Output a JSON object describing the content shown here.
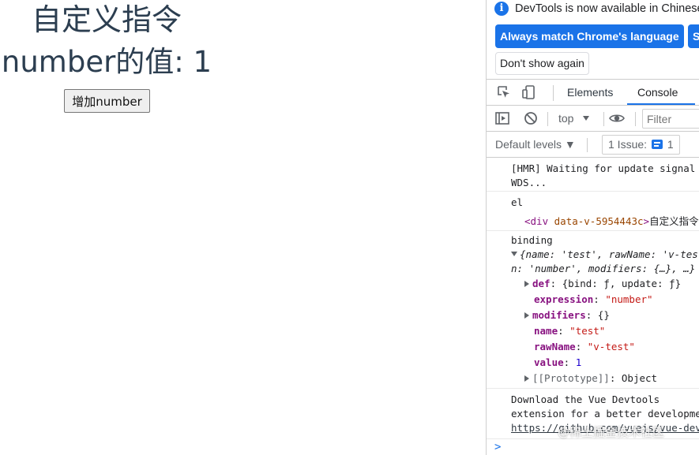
{
  "app": {
    "heading": "自定义指令",
    "number_text": "number的值: 1",
    "increment_button": "增加number"
  },
  "devtools": {
    "infobar": {
      "message": "DevTools is now available in Chinese",
      "always_match_button": "Always match Chrome's language",
      "switch_button": "Sw",
      "dont_show_button": "Don't show again"
    },
    "tabs": [
      {
        "label": "Elements",
        "active": false
      },
      {
        "label": "Console",
        "active": true
      }
    ],
    "toolbar": {
      "context": "top",
      "filter_placeholder": "Filter"
    },
    "levels": {
      "label": "Default levels ▼",
      "issues_prefix": "1 Issue:",
      "issues_count": "1"
    },
    "console": {
      "hmr_line1": "[HMR] Waiting for update signal from",
      "hmr_line2": "WDS...",
      "el_label": "el",
      "el_tag_open": "<div ",
      "el_attr": "data-v-5954443c",
      "el_tag_close": ">",
      "el_text": "自定义指令</div>",
      "binding_label": "binding",
      "obj_line1": "{name: 'test', rawName: 'v-test', expressio",
      "obj_line2": "n: 'number', modifiers: {…}, …}",
      "props": {
        "def_key": "def",
        "def_val": "{bind: ƒ, update: ƒ}",
        "expression_key": "expression",
        "expression_val": "\"number\"",
        "modifiers_key": "modifiers",
        "modifiers_val": "{}",
        "name_key": "name",
        "name_val": "\"test\"",
        "rawName_key": "rawName",
        "rawName_val": "\"v-test\"",
        "value_key": "value",
        "value_val": "1",
        "proto_key": "[[Prototype]]",
        "proto_val": "Object"
      },
      "vue_line1": "Download the Vue Devtools",
      "vue_line2": "extension for a better development",
      "vue_link": "https://github.com/vuejs/vue-devtools"
    },
    "watermark": "@稀土掘金技术社区"
  }
}
